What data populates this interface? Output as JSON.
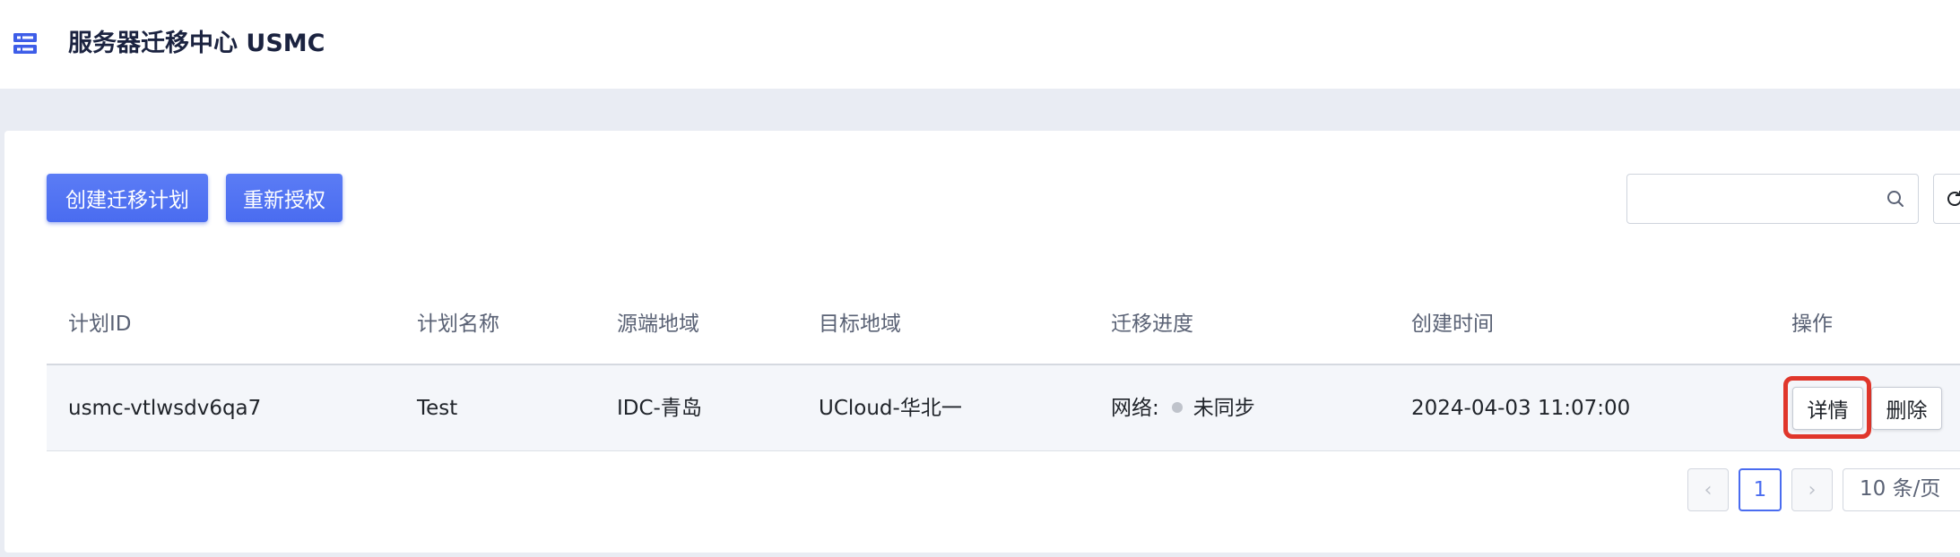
{
  "app": {
    "title": "服务器迁移中心 USMC"
  },
  "toolbar": {
    "create_label": "创建迁移计划",
    "reauth_label": "重新授权",
    "search_placeholder": ""
  },
  "table": {
    "headers": [
      "计划ID",
      "计划名称",
      "源端地域",
      "目标地域",
      "迁移进度",
      "创建时间",
      "操作"
    ],
    "rows": [
      {
        "id": "usmc-vtlwsdv6qa7",
        "name": "Test",
        "source": "IDC-青岛",
        "target": "UCloud-华北一",
        "progress_label": "网络:",
        "progress_status": "未同步",
        "created": "2024-04-03 11:07:00",
        "actions": {
          "detail": "详情",
          "delete": "删除"
        }
      }
    ]
  },
  "pagination": {
    "prev": "‹",
    "current": "1",
    "next": "›",
    "page_size": "10 条/页"
  },
  "colors": {
    "accent": "#4a6cf0",
    "highlight": "#e0362b",
    "status_dot": "#bfc3cb"
  }
}
